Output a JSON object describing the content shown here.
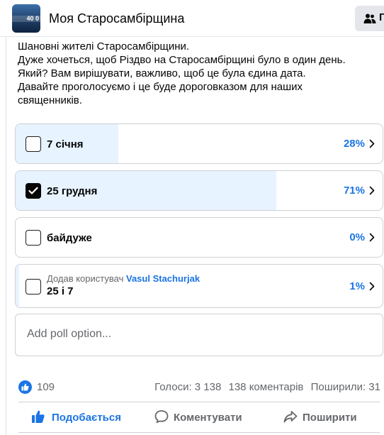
{
  "header": {
    "group_name": "Моя Старосамбірщина",
    "avatar_text": "40 0",
    "members_button_label": "Г"
  },
  "post": {
    "lines": [
      "Шановні жителі Старосамбірщини.",
      "Дуже хочеться, щоб Різдво на Старосамбірщині було в один день.",
      "Який? Вам вирішувати, важливо, щоб це була єдина дата.",
      "Давайте проголосуємо і це буде дороговказом для наших",
      "священників."
    ]
  },
  "poll": {
    "options": [
      {
        "label": "7 січня",
        "percent_text": "28%",
        "percent": 28,
        "checked": false
      },
      {
        "label": "25 грудня",
        "percent_text": "71%",
        "percent": 71,
        "checked": true
      },
      {
        "label": "байдуже",
        "percent_text": "0%",
        "percent": 0,
        "checked": false
      },
      {
        "label": "25 і 7",
        "percent_text": "1%",
        "percent": 1,
        "checked": false,
        "added_by_prefix": "Додав користувач",
        "added_by_user": "Vasul Stachurjak"
      }
    ],
    "add_option_placeholder": "Add poll option..."
  },
  "stats": {
    "reactions": "109",
    "votes": "Голоси: 3 138",
    "comments": "138 коментарів",
    "shares": "Поширили: 31"
  },
  "actions": {
    "like": "Подобається",
    "comment": "Коментувати",
    "share": "Поширити"
  },
  "colors": {
    "accent": "#1b74e4",
    "poll_fill": "#e7f3ff",
    "secondary_text": "#65676b",
    "border": "#ced0d4"
  }
}
